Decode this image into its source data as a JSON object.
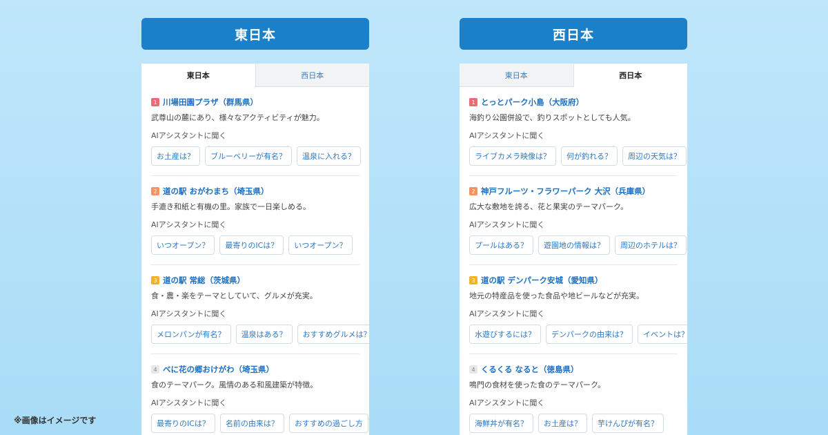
{
  "east": {
    "header": "東日本",
    "tabs": [
      "東日本",
      "西日本"
    ],
    "items": [
      {
        "rank": "1",
        "title": "川場田園プラザ（群馬県）",
        "desc": "武尊山の麓にあり、様々なアクティビティが魅力。",
        "ai_label": "AIアシスタントに聞く",
        "chips": [
          "お土産は？",
          "ブルーベリーが有名？",
          "温泉に入れる？"
        ]
      },
      {
        "rank": "2",
        "title": "道の駅 おがわまち（埼玉県）",
        "desc": "手漉き和紙と有機の里。家族で一日楽しめる。",
        "ai_label": "AIアシスタントに聞く",
        "chips": [
          "いつオープン？",
          "最寄りのICは？",
          "いつオープン？"
        ]
      },
      {
        "rank": "3",
        "title": "道の駅 常総（茨城県）",
        "desc": "食・農・楽をテーマとしていて、グルメが充実。",
        "ai_label": "AIアシスタントに聞く",
        "chips": [
          "メロンパンが有名？",
          "温泉はある？",
          "おすすめグルメは？"
        ]
      },
      {
        "rank": "4",
        "title": "べに花の郷おけがわ（埼玉県）",
        "desc": "食のテーマパーク。風情のある和風建築が特徴。",
        "ai_label": "AIアシスタントに聞く",
        "chips": [
          "最寄りのICは？",
          "名前の由来は？",
          "おすすめの過ごし方"
        ]
      }
    ]
  },
  "west": {
    "header": "西日本",
    "tabs": [
      "東日本",
      "西日本"
    ],
    "items": [
      {
        "rank": "1",
        "title": "とっとパーク小島（大阪府）",
        "desc": "海釣り公園併設で、釣りスポットとしても人気。",
        "ai_label": "AIアシスタントに聞く",
        "chips": [
          "ライブカメラ映像は？",
          "何が釣れる？",
          "周辺の天気は？"
        ]
      },
      {
        "rank": "2",
        "title": "神戸フルーツ・フラワーパーク 大沢（兵庫県）",
        "desc": "広大な敷地を誇る、花と果実のテーマパーク。",
        "ai_label": "AIアシスタントに聞く",
        "chips": [
          "プールはある？",
          "遊園地の情報は？",
          "周辺のホテルは？"
        ]
      },
      {
        "rank": "3",
        "title": "道の駅 デンパーク安城（愛知県）",
        "desc": "地元の特産品を使った食品や地ビールなどが充実。",
        "ai_label": "AIアシスタントに聞く",
        "chips": [
          "水遊びするには？",
          "デンパークの由来は？",
          "イベントは？"
        ]
      },
      {
        "rank": "4",
        "title": "くるくる なると（徳島県）",
        "desc": "鳴門の食材を使った食のテーマパーク。",
        "ai_label": "AIアシスタントに聞く",
        "chips": [
          "海鮮丼が有名？",
          "お土産は？",
          "芋けんぴが有名？"
        ]
      }
    ]
  },
  "note": "※画像はイメージです"
}
